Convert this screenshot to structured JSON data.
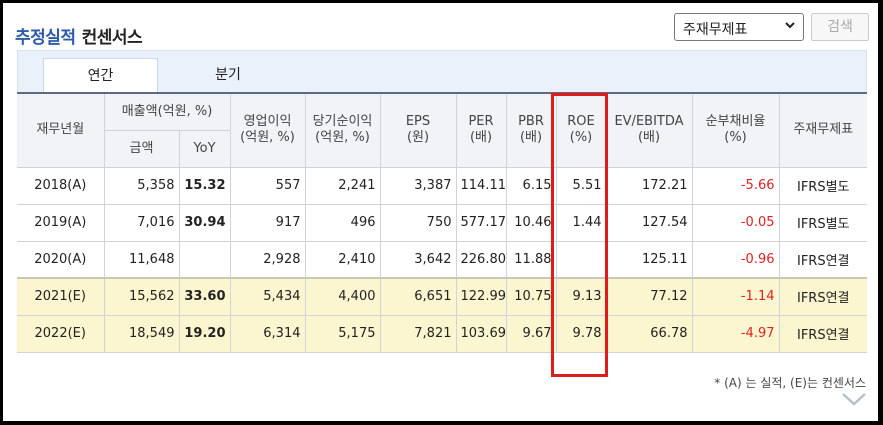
{
  "header": {
    "title_primary": "추정실적",
    "title_secondary": "컨센서스",
    "select_value": "주재무제표",
    "search_label": "검색"
  },
  "tabs": [
    {
      "label": "연간"
    },
    {
      "label": "분기"
    }
  ],
  "table": {
    "head": {
      "year": "재무년월",
      "sales_group": "매출액(억원, %)",
      "sales_amount": "금액",
      "sales_yoy": "YoY",
      "op_profit": "영업이익\n(억원, %)",
      "net_profit": "당기순이익\n(억원, %)",
      "eps": "EPS\n(원)",
      "per": "PER\n(배)",
      "pbr": "PBR\n(배)",
      "roe": "ROE\n(%)",
      "ev_ebitda": "EV/EBITDA\n(배)",
      "debt_ratio": "순부채비율\n(%)",
      "statement": "주재무제표"
    },
    "rows": [
      {
        "year": "2018(A)",
        "sales": "5,358",
        "yoy": "15.32",
        "op": "557",
        "net": "2,241",
        "eps": "3,387",
        "per": "114.11",
        "pbr": "6.15",
        "roe": "5.51",
        "ev": "172.21",
        "debt": "-5.66",
        "std": "IFRS별도"
      },
      {
        "year": "2019(A)",
        "sales": "7,016",
        "yoy": "30.94",
        "op": "917",
        "net": "496",
        "eps": "750",
        "per": "577.17",
        "pbr": "10.46",
        "roe": "1.44",
        "ev": "127.54",
        "debt": "-0.05",
        "std": "IFRS별도"
      },
      {
        "year": "2020(A)",
        "sales": "11,648",
        "yoy": "",
        "op": "2,928",
        "net": "2,410",
        "eps": "3,642",
        "per": "226.80",
        "pbr": "11.88",
        "roe": "",
        "ev": "125.11",
        "debt": "-0.96",
        "std": "IFRS연결"
      },
      {
        "year": "2021(E)",
        "sales": "15,562",
        "yoy": "33.60",
        "op": "5,434",
        "net": "4,400",
        "eps": "6,651",
        "per": "122.99",
        "pbr": "10.75",
        "roe": "9.13",
        "ev": "77.12",
        "debt": "-1.14",
        "std": "IFRS연결"
      },
      {
        "year": "2022(E)",
        "sales": "18,549",
        "yoy": "19.20",
        "op": "6,314",
        "net": "5,175",
        "eps": "7,821",
        "per": "103.69",
        "pbr": "9.67",
        "roe": "9.78",
        "ev": "66.78",
        "debt": "-4.97",
        "std": "IFRS연결"
      }
    ]
  },
  "footnote": "* (A) 는 실적, (E)는 컨센서스",
  "colors": {
    "accent": "#2b5aa8",
    "negative": "#dd2222",
    "estimate_bg": "#fbf6cf",
    "highlight": "#e01b1b"
  }
}
